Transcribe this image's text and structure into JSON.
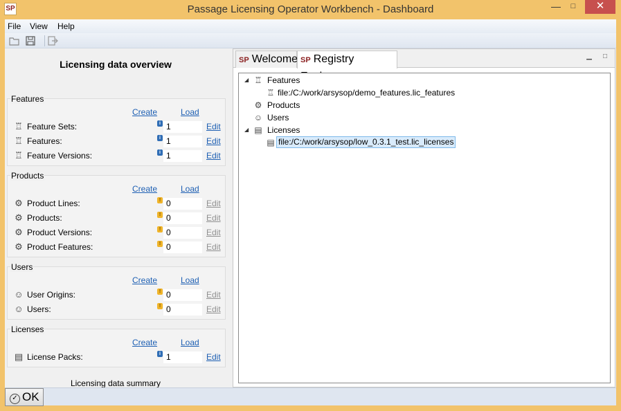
{
  "window": {
    "title": "Passage Licensing Operator Workbench - Dashboard",
    "app_icon": "SP",
    "minimize": "—",
    "maximize": "□",
    "close": "✕"
  },
  "menu": [
    "File",
    "View",
    "Help"
  ],
  "toolbar": {
    "icons": [
      "open-folder-icon",
      "save-icon",
      "exit-icon"
    ]
  },
  "overview": {
    "title": "Licensing data overview",
    "summary": "Licensing data summary",
    "create_label": "Create",
    "load_label": "Load",
    "edit_label": "Edit",
    "sections": [
      {
        "title": "Features",
        "rows": [
          {
            "label": "Feature Sets:",
            "count": "1",
            "status": "info"
          },
          {
            "label": "Features:",
            "count": "1",
            "status": "info"
          },
          {
            "label": "Feature Versions:",
            "count": "1",
            "status": "info"
          }
        ]
      },
      {
        "title": "Products",
        "rows": [
          {
            "label": "Product Lines:",
            "count": "0",
            "status": "warning"
          },
          {
            "label": "Products:",
            "count": "0",
            "status": "warning"
          },
          {
            "label": "Product Versions:",
            "count": "0",
            "status": "warning"
          },
          {
            "label": "Product Features:",
            "count": "0",
            "status": "warning"
          }
        ]
      },
      {
        "title": "Users",
        "rows": [
          {
            "label": "User Origins:",
            "count": "0",
            "status": "warning"
          },
          {
            "label": "Users:",
            "count": "0",
            "status": "warning"
          }
        ]
      },
      {
        "title": "Licenses",
        "rows": [
          {
            "label": "License Packs:",
            "count": "1",
            "status": "info"
          }
        ]
      }
    ]
  },
  "tabs": [
    {
      "label": "Welcome",
      "active": false
    },
    {
      "label": "Registry Explorer",
      "active": true
    }
  ],
  "tree": [
    {
      "label": "Features",
      "level": 0,
      "expanded": true
    },
    {
      "label": "file:/C:/work/arsysop/demo_features.lic_features",
      "level": 1
    },
    {
      "label": "Products",
      "level": 0
    },
    {
      "label": "Users",
      "level": 0
    },
    {
      "label": "Licenses",
      "level": 0,
      "expanded": true
    },
    {
      "label": "file:/C:/work/arsysop/low_0.3.1_test.lic_licenses",
      "level": 1,
      "selected": true
    }
  ],
  "ok_button": "OK",
  "colors": {
    "title_bar": "#f2c36b",
    "link": "#1d5fb3",
    "close_button": "#c7504e",
    "selection": "#d9ebfb"
  }
}
